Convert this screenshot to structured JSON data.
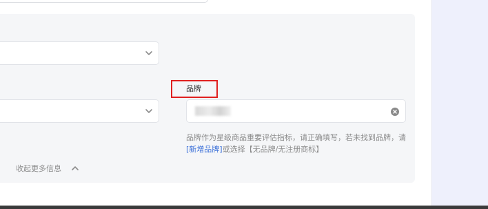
{
  "form": {
    "brand": {
      "label": "品牌",
      "hint_text_1": "品牌作为星级商品重要评估指标，请正确填写，若未找到品牌，请",
      "hint_link": "[新增品牌]",
      "hint_text_2": "或选择【无品牌/无注册商标】"
    },
    "collapse_label": "收起更多信息"
  },
  "colors": {
    "panel_bg": "#f5f6f8",
    "highlight_border": "#e02020",
    "link": "#3a6fd8",
    "right_strip_bg": "#eef0fc"
  },
  "icons": {
    "select_chevron": "chevron-down-icon",
    "clear": "clear-circle-icon",
    "collapse": "chevron-up-icon"
  }
}
